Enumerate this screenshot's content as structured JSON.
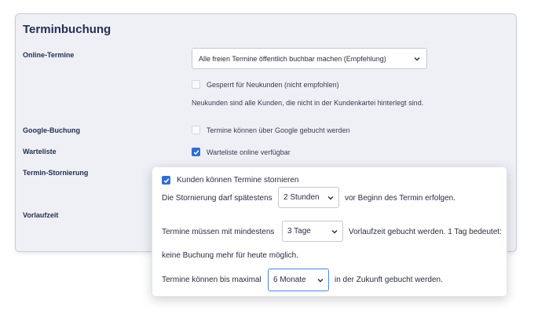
{
  "section": {
    "title": "Terminbuchung"
  },
  "labels": {
    "online": "Online-Termine",
    "google": "Google-Buchung",
    "warteliste": "Warteliste",
    "stornierung": "Termin-Stornierung",
    "vorlaufzeit": "Vorlaufzeit"
  },
  "online": {
    "select_value": "Alle freien Termine öffentlich buchbar machen (Empfehlung)",
    "locked_label": "Gesperrt für Neukunden (nicht empfohlen)",
    "locked_checked": false,
    "note": "Neukunden sind alle Kunden, die nicht in der Kundenkartei hinterlegt sind."
  },
  "google": {
    "label": "Termine können über Google gebucht werden",
    "checked": false
  },
  "warteliste": {
    "label": "Warteliste online verfügbar",
    "checked": true
  },
  "popup": {
    "cancel_label": "Kunden können Termine stornieren",
    "cancel_checked": true,
    "storno_prefix": "Die Stornierung darf spätestens",
    "storno_value": "2 Stunden",
    "storno_suffix": "vor Beginn des Termin erfolgen.",
    "lead_prefix": "Termine müssen mit mindestens",
    "lead_value": "3 Tage",
    "lead_suffix": "Vorlaufzeit gebucht werden. 1 Tag bedeutet:",
    "lead_note": "keine Buchung mehr für heute möglich.",
    "max_prefix": "Termine können bis maximal",
    "max_value": "6 Monate",
    "max_suffix": "in der Zukunft gebucht werden."
  },
  "colors": {
    "accent": "#2f6fd4",
    "title": "#263050",
    "panel_bg": "#eef0f5"
  }
}
